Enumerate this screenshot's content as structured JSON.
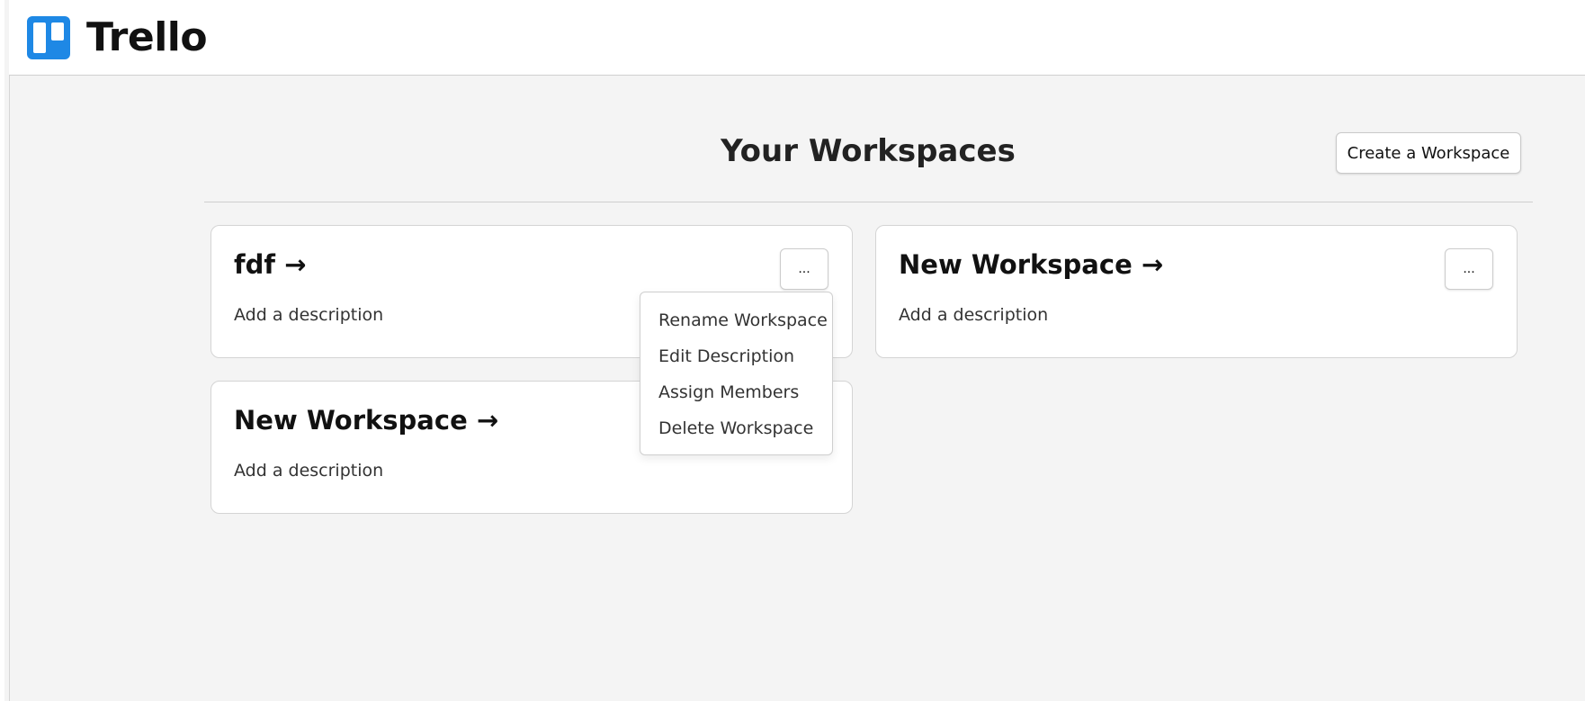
{
  "app": {
    "name": "Trello",
    "logo_icon": "trello-board-icon",
    "brand_color": "#1e88e5"
  },
  "header": {
    "title": "Your Workspaces",
    "create_button_label": "Create a Workspace"
  },
  "workspaces": [
    {
      "title": "fdf →",
      "description": "Add a description",
      "more_label": "..."
    },
    {
      "title": "New Workspace →",
      "description": "Add a description",
      "more_label": "..."
    },
    {
      "title": "New Workspace →",
      "description": "Add a description",
      "more_label": "..."
    }
  ],
  "dropdown_menu": {
    "items": [
      "Rename Workspace",
      "Edit Description",
      "Assign Members",
      "Delete Workspace"
    ]
  }
}
